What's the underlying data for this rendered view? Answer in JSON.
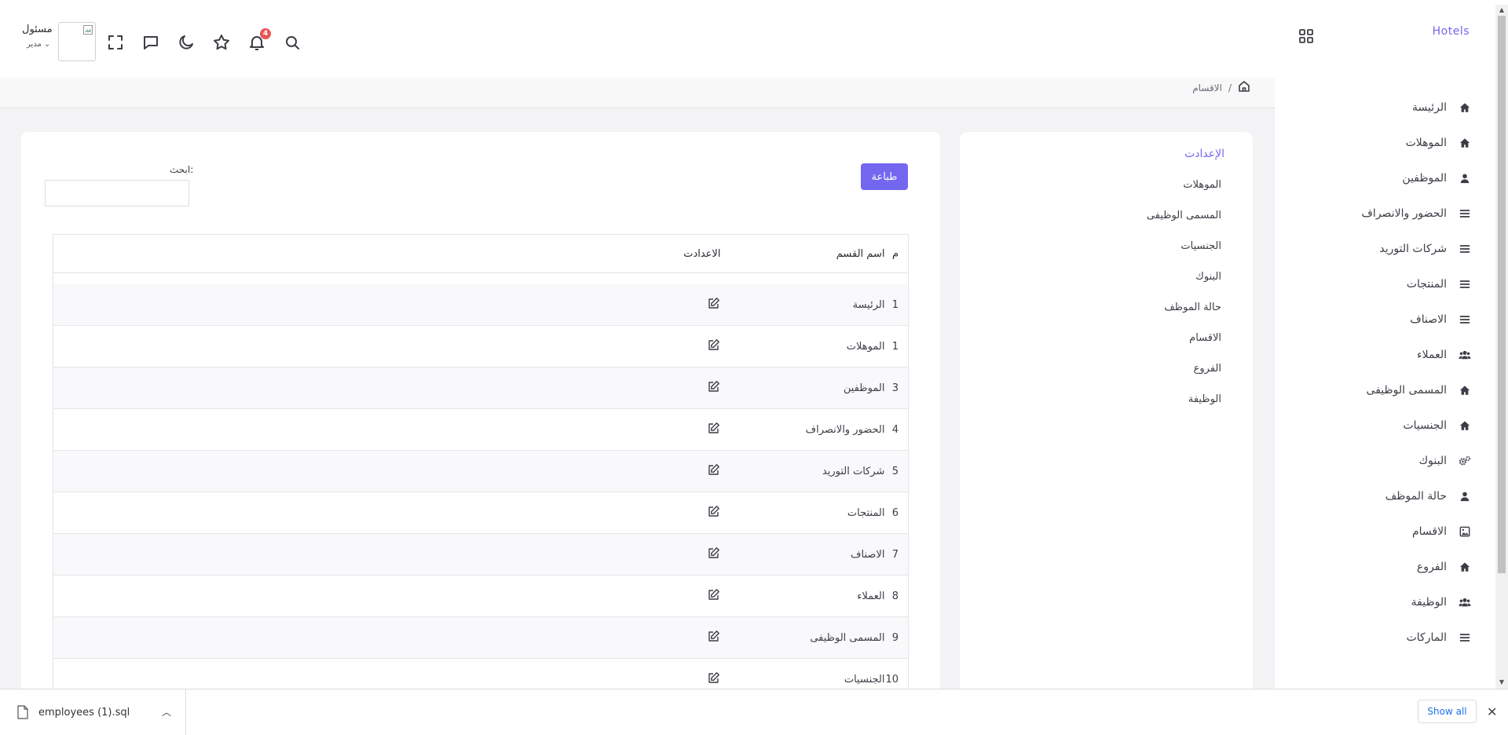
{
  "brand": "Hotels",
  "sidebar": {
    "items": [
      {
        "label": "الرئيسة",
        "icon": "home-icon"
      },
      {
        "label": "الموهلات",
        "icon": "home-icon"
      },
      {
        "label": "الموظفين",
        "icon": "user-icon"
      },
      {
        "label": "الحضور والانصراف",
        "icon": "menu-lines-icon"
      },
      {
        "label": "شركات التوريد",
        "icon": "menu-lines-icon"
      },
      {
        "label": "المنتجات",
        "icon": "menu-lines-icon"
      },
      {
        "label": "الاصناف",
        "icon": "menu-lines-icon"
      },
      {
        "label": "العملاء",
        "icon": "users-icon"
      },
      {
        "label": "المسمى الوظيفى",
        "icon": "home-icon"
      },
      {
        "label": "الجنسيات",
        "icon": "home-icon"
      },
      {
        "label": "البنوك",
        "icon": "cogs-icon"
      },
      {
        "label": "حالة الموظف",
        "icon": "user-icon"
      },
      {
        "label": "الاقسام",
        "icon": "image-icon"
      },
      {
        "label": "الفروع",
        "icon": "home-icon"
      },
      {
        "label": "الوظيفة",
        "icon": "users-icon"
      },
      {
        "label": "الماركات",
        "icon": "menu-lines-icon"
      }
    ]
  },
  "header": {
    "notification_count": "4",
    "user_name": "مسئول",
    "user_role": "مدير"
  },
  "breadcrumb": {
    "separator": "/",
    "current": "الاقسام"
  },
  "settings": {
    "title": "الإعدادت",
    "items": [
      "الموهلات",
      "المسمى الوظيفى",
      "الجنسيات",
      "البنوك",
      "حالة الموظف",
      "الاقسام",
      "الفروع",
      "الوظيفة"
    ]
  },
  "main": {
    "print_label": "طباعة",
    "search_label": "ابحث:",
    "table": {
      "headers": {
        "index": "م",
        "name": "اسم القسم",
        "settings": "الاعدادت"
      },
      "rows": [
        {
          "index": "1",
          "name": "الرئيسة"
        },
        {
          "index": "1",
          "name": "الموهلات"
        },
        {
          "index": "3",
          "name": "الموظفين"
        },
        {
          "index": "4",
          "name": "الحضور والانصراف"
        },
        {
          "index": "5",
          "name": "شركات التوريد"
        },
        {
          "index": "6",
          "name": "المنتجات"
        },
        {
          "index": "7",
          "name": "الاصناف"
        },
        {
          "index": "8",
          "name": "العملاء"
        },
        {
          "index": "9",
          "name": "المسمى الوظيفى"
        },
        {
          "index": "10",
          "name": "الجنسيات"
        }
      ]
    }
  },
  "downloads": {
    "file_name": "employees (1).sql",
    "show_all": "Show all"
  },
  "colors": {
    "accent": "#7367f0",
    "badge": "#ea5455"
  }
}
